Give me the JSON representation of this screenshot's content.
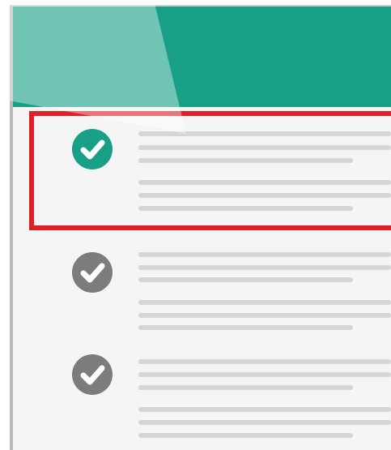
{
  "colors": {
    "header": "#17a085",
    "page": "#f5f5f5",
    "highlight_border": "#e02027",
    "check_active": "#17a085",
    "check_inactive": "#7c7c7c",
    "placeholder_line": "#d6d6d6"
  },
  "checklist": {
    "items": [
      {
        "icon": "check-circle-icon",
        "state": "active",
        "highlighted": true
      },
      {
        "icon": "check-circle-icon",
        "state": "inactive",
        "highlighted": false
      },
      {
        "icon": "check-circle-icon",
        "state": "inactive",
        "highlighted": false
      }
    ]
  }
}
